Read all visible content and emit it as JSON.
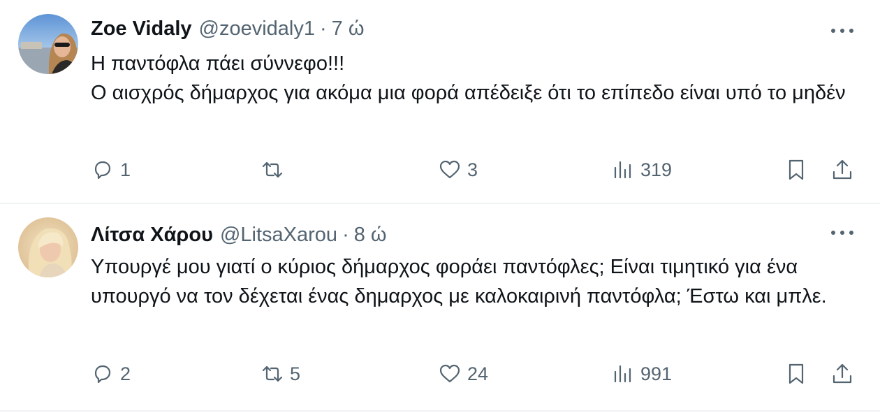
{
  "tweets": [
    {
      "name": "Zoe Vidaly",
      "handle": "@zoevidaly1",
      "separator": "·",
      "time": "7 ώ",
      "lines": [
        "Η παντόφλα πάει σύννεφο!!!",
        "Ο αισχρός δήμαρχος για ακόμα μια φορά απέδειξε ότι το επίπεδο είναι υπό το μηδέν"
      ],
      "replies": "1",
      "retweets": "",
      "likes": "3",
      "views": "319"
    },
    {
      "name": "Λίτσα Χάρου",
      "handle": "@LitsaXarou",
      "separator": "·",
      "time": "8 ώ",
      "lines": [
        "Υπουργέ μου γιατί ο κύριος δήμαρχος φοράει παντόφλες; Είναι τιμητικό για ένα υπουργό να τον δέχεται ένας δημαρχος με καλοκαιρινή παντόφλα; Έστω και μπλε."
      ],
      "replies": "2",
      "retweets": "5",
      "likes": "24",
      "views": "991"
    }
  ],
  "icons": {
    "reply": "reply-icon",
    "retweet": "retweet-icon",
    "like": "heart-icon",
    "views": "views-icon",
    "bookmark": "bookmark-icon",
    "share": "share-icon",
    "more": "more-icon"
  },
  "colors": {
    "text": "#0f1419",
    "secondary": "#536471",
    "divider": "#eff3f4"
  }
}
